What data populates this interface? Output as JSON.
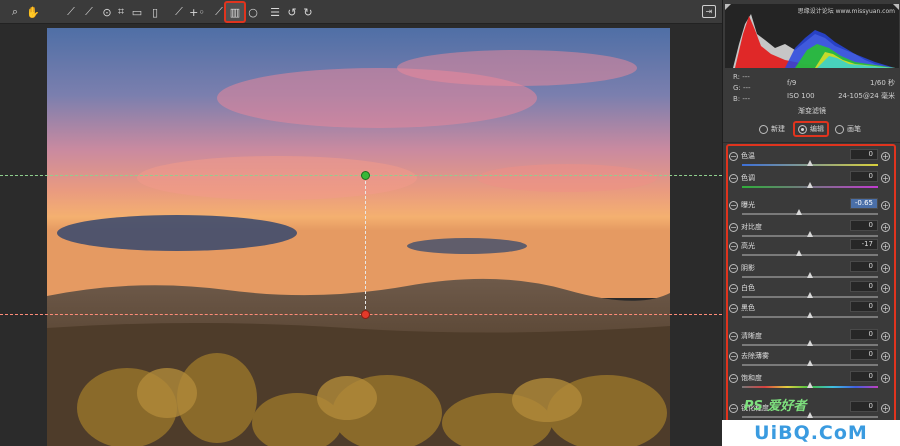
{
  "toolbar": {
    "tools": [
      {
        "icon": "zoom-icon",
        "glyph": "⌕"
      },
      {
        "icon": "hand-icon",
        "glyph": "✋"
      },
      {
        "icon": "white-balance-icon",
        "glyph": "⟋"
      },
      {
        "icon": "color-sampler-icon",
        "glyph": "⟋"
      },
      {
        "icon": "target-adjust-icon",
        "glyph": "⊙"
      },
      {
        "icon": "crop-icon",
        "glyph": "⌗"
      },
      {
        "icon": "straighten-icon",
        "glyph": "▭"
      },
      {
        "icon": "transform-icon",
        "glyph": "▯"
      },
      {
        "icon": "spot-removal-icon",
        "glyph": "⟋"
      },
      {
        "icon": "red-eye-icon",
        "glyph": "+◦"
      },
      {
        "icon": "adjustment-brush-icon",
        "glyph": "⟋"
      },
      {
        "icon": "graduated-filter-icon",
        "glyph": "▥"
      },
      {
        "icon": "radial-filter-icon",
        "glyph": "○"
      },
      {
        "icon": "preferences-icon",
        "glyph": "☰"
      },
      {
        "icon": "rotate-left-icon",
        "glyph": "↺"
      },
      {
        "icon": "rotate-right-icon",
        "glyph": "↻"
      }
    ],
    "active_tool": "graduated-filter-icon"
  },
  "histogram": {
    "watermark": "思缘设计论坛 www.missyuan.com"
  },
  "readout": {
    "r": "R:  ---",
    "g": "G:  ---",
    "b": "B:  ---"
  },
  "camera": {
    "aperture": "f/9",
    "shutter": "1/60 秒",
    "iso": "ISO 100",
    "lens": "24-105@24 毫米"
  },
  "panel": {
    "title": "渐变滤镜"
  },
  "modes": {
    "new": "新建",
    "edit": "编辑",
    "brush": "画笔",
    "selected": "edit"
  },
  "sliders": [
    {
      "label": "色温",
      "value": "0",
      "track": "temp",
      "pos": 0.5
    },
    {
      "label": "色调",
      "value": "0",
      "track": "tint",
      "pos": 0.5
    },
    {
      "label": "曝光",
      "value": "-0.65",
      "track": "plain",
      "pos": 0.42,
      "selected": true
    },
    {
      "label": "对比度",
      "value": "0",
      "track": "plain",
      "pos": 0.5
    },
    {
      "label": "高光",
      "value": "-17",
      "track": "plain",
      "pos": 0.42
    },
    {
      "label": "阴影",
      "value": "0",
      "track": "plain",
      "pos": 0.5
    },
    {
      "label": "白色",
      "value": "0",
      "track": "plain",
      "pos": 0.5
    },
    {
      "label": "黑色",
      "value": "0",
      "track": "plain",
      "pos": 0.5
    },
    {
      "label": "清晰度",
      "value": "0",
      "track": "plain",
      "pos": 0.5
    },
    {
      "label": "去除薄雾",
      "value": "0",
      "track": "plain",
      "pos": 0.5
    },
    {
      "label": "饱和度",
      "value": "0",
      "track": "sat",
      "pos": 0.5
    },
    {
      "label": "锐化程度",
      "value": "0",
      "track": "plain",
      "pos": 0.5
    }
  ],
  "watermarks": {
    "ps": "PS 爱好者",
    "site": "UiBQ.CoM"
  },
  "colors": {
    "highlight": "#e0341e",
    "guide_top": "#38b838",
    "guide_bottom": "#e33a2a"
  }
}
